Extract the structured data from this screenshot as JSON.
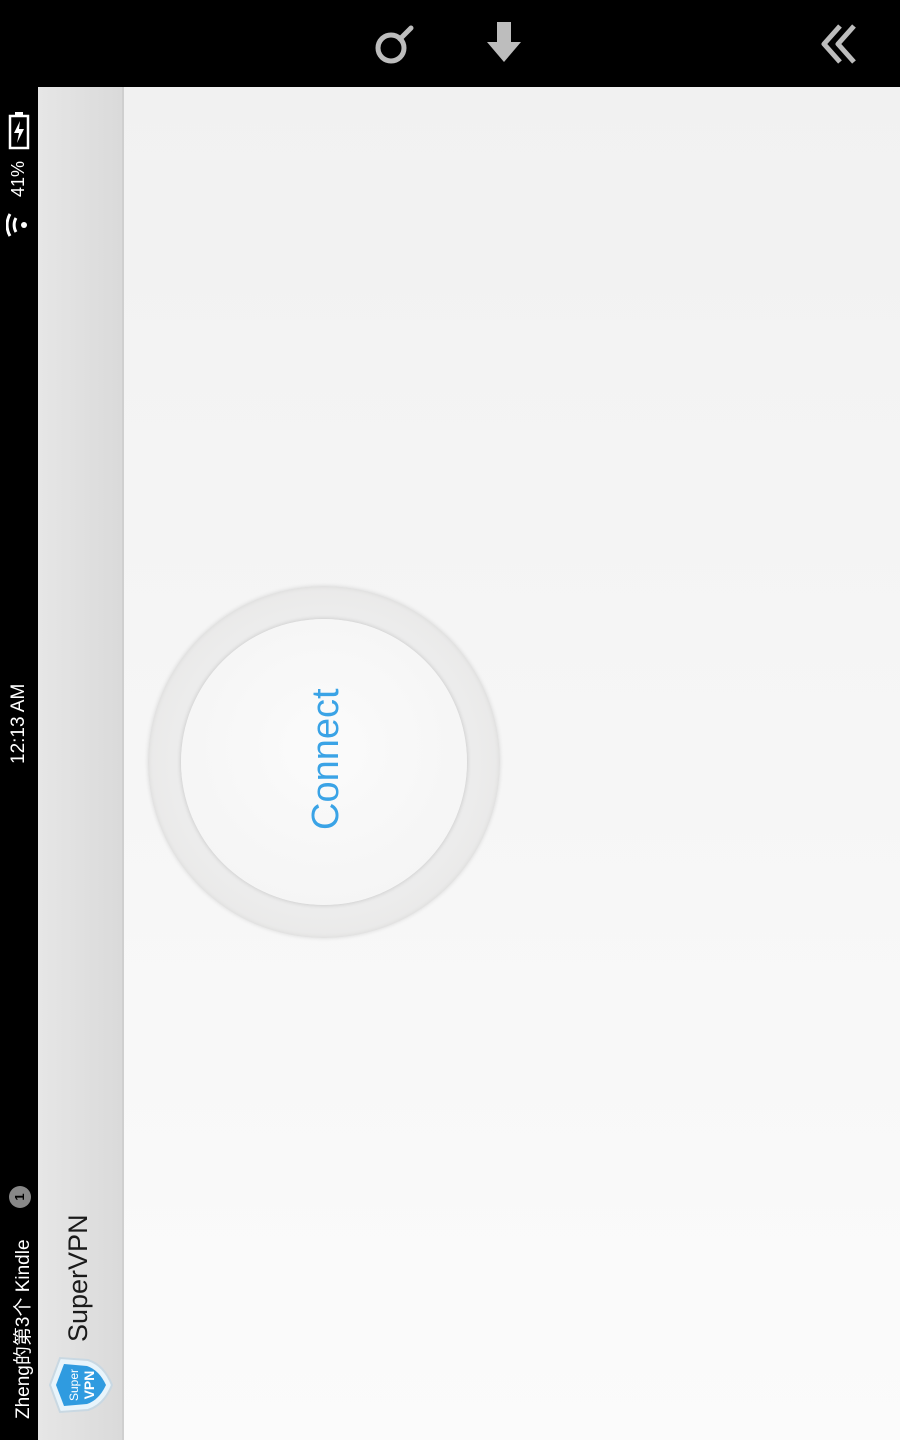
{
  "statusbar": {
    "device_name": "Zheng的第3个 Kindle",
    "notification_count": "1",
    "clock": "12:13 AM",
    "battery_percent": "41%"
  },
  "navbar": {
    "icons": [
      "search-icon",
      "home-icon",
      "back-icon"
    ]
  },
  "actionbar": {
    "app_title": "SuperVPN",
    "logo_text_top": "Super",
    "logo_text_bottom": "VPN"
  },
  "main": {
    "connect_label": "Connect",
    "accent_color": "#3aa3e6"
  }
}
